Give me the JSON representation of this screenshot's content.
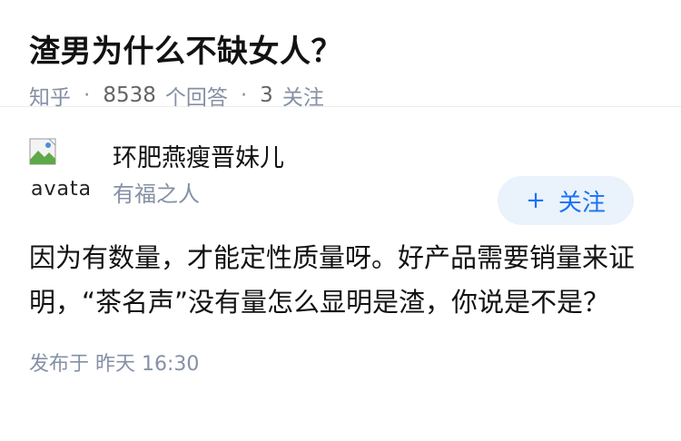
{
  "question": {
    "title": "渣男为什么不缺女人？",
    "source": "知乎",
    "answer_count": "8538",
    "answer_label": "个回答",
    "follow_count": "3",
    "follow_label": "关注"
  },
  "author": {
    "avatar_alt": "avatar",
    "name": "环肥燕瘦晋妹儿",
    "bio": "有福之人",
    "follow_button": "关注",
    "follow_plus": "+"
  },
  "answer": {
    "text": "因为有数量，才能定性质量呀。好产品需要销量来证明，“茶名声”没有量怎么显明是渣，你说是不是？",
    "published": "发布于  昨天 16:30"
  },
  "colors": {
    "accent": "#1772f6",
    "muted": "#8590a6",
    "button_bg": "#eaf2fb"
  }
}
